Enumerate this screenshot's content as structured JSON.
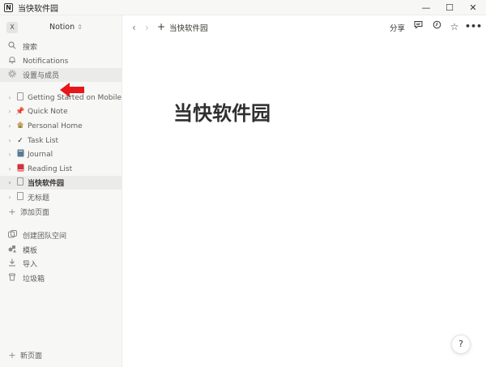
{
  "window": {
    "title": "当快软件园",
    "app_icon": "N",
    "minimize": "—",
    "maximize": "☐",
    "close": "✕"
  },
  "sidebar": {
    "workspace": {
      "avatar": "X",
      "name": "Notion",
      "switch_icon": "⌃"
    },
    "top": [
      {
        "label": "搜索",
        "icon": "search-icon"
      },
      {
        "label": "Notifications",
        "icon": "bell-icon"
      },
      {
        "label": "设置与成员",
        "icon": "gear-icon"
      }
    ],
    "pages": [
      {
        "label": "Getting Started on Mobile",
        "icon": "page-icon"
      },
      {
        "label": "Quick Note",
        "icon": "pin-icon"
      },
      {
        "label": "Personal Home",
        "icon": "house-icon"
      },
      {
        "label": "Task List",
        "icon": "check-icon"
      },
      {
        "label": "Journal",
        "icon": "notebook-icon"
      },
      {
        "label": "Reading List",
        "icon": "book-icon"
      },
      {
        "label": "当快软件园",
        "icon": "page-icon"
      },
      {
        "label": "无标题",
        "icon": "page-icon"
      }
    ],
    "add_page": "添加页面",
    "bottom": [
      {
        "label": "创建团队空间",
        "icon": "teamspace-icon"
      },
      {
        "label": "模板",
        "icon": "template-icon"
      },
      {
        "label": "导入",
        "icon": "import-icon"
      },
      {
        "label": "垃圾箱",
        "icon": "trash-icon"
      }
    ],
    "new_page": "新页面"
  },
  "topbar": {
    "breadcrumb": "当快软件园",
    "share": "分享"
  },
  "page": {
    "title": "当快软件园"
  },
  "help_label": "?",
  "colors": {
    "sidebar_bg": "#f7f7f5",
    "selected_bg": "#ebebea",
    "text": "#37352f",
    "arrow_red": "#e8161b"
  }
}
